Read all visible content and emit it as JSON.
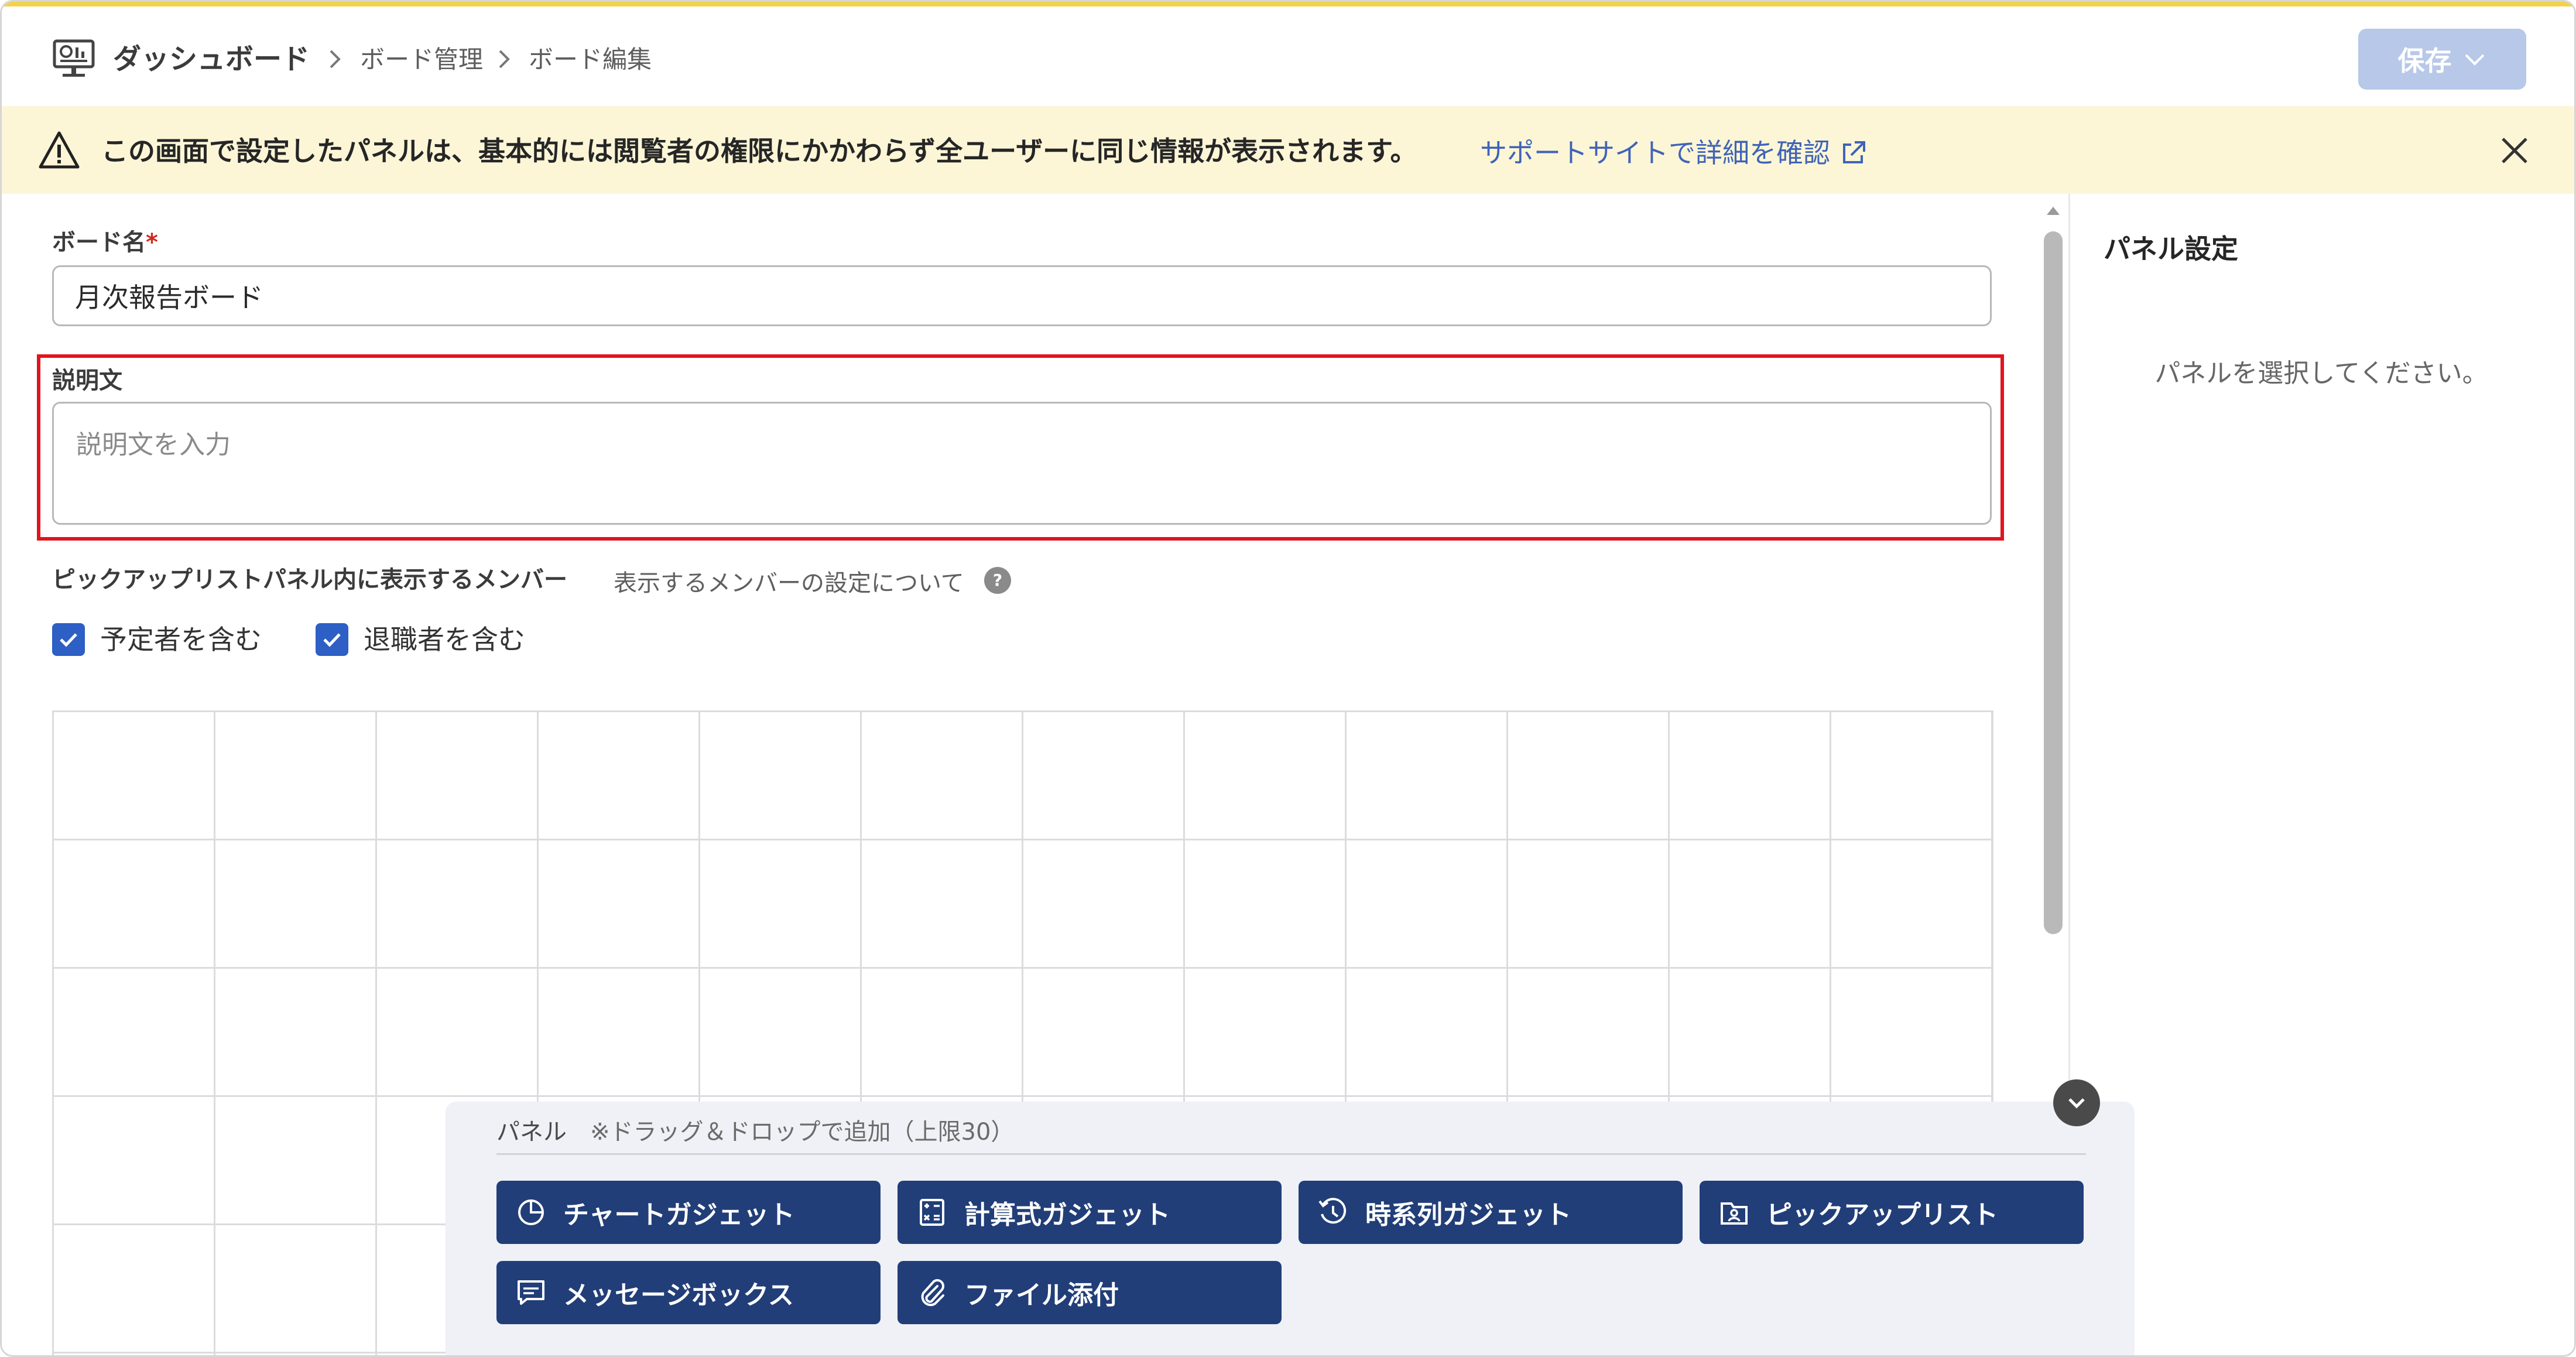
{
  "header": {
    "breadcrumb": [
      "ダッシュボード",
      "ボード管理",
      "ボード編集"
    ],
    "save_label": "保存"
  },
  "banner": {
    "message": "この画面で設定したパネルは、基本的には閲覧者の権限にかかわらず全ユーザーに同じ情報が表示されます。",
    "link": "サポートサイトで詳細を確認"
  },
  "form": {
    "board_name_label": "ボード名",
    "required_mark": "*",
    "board_name_value": "月次報告ボード",
    "description_label": "説明文",
    "description_placeholder": "説明文を入力",
    "members_label": "ピックアップリストパネル内に表示するメンバー",
    "members_help": "表示するメンバーの設定について",
    "checkboxes": [
      {
        "label": "予定者を含む",
        "checked": true
      },
      {
        "label": "退職者を含む",
        "checked": true
      }
    ]
  },
  "side_panel": {
    "title": "パネル設定",
    "empty_message": "パネルを選択してください。"
  },
  "palette": {
    "title": "パネル",
    "note": "※ドラッグ＆ドロップで追加（上限30）",
    "buttons": [
      {
        "label": "チャートガジェット",
        "icon": "pie-chart-icon"
      },
      {
        "label": "計算式ガジェット",
        "icon": "calculator-icon"
      },
      {
        "label": "時系列ガジェット",
        "icon": "time-series-icon"
      },
      {
        "label": "ピックアップリスト",
        "icon": "pickup-list-icon"
      },
      {
        "label": "メッセージボックス",
        "icon": "message-icon"
      },
      {
        "label": "ファイル添付",
        "icon": "paperclip-icon"
      }
    ]
  },
  "colors": {
    "accent": "#213e78",
    "save_disabled": "#b7c8e8",
    "banner_bg": "#fcf6d7",
    "link": "#3f63b7",
    "highlight": "#e0141e",
    "checkbox": "#2d5fc4"
  }
}
